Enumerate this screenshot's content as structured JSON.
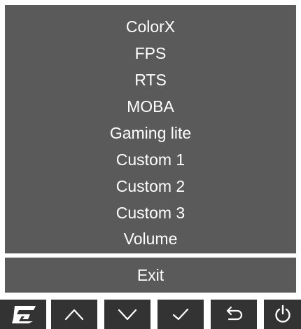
{
  "menu": {
    "items": [
      {
        "label": "ColorX"
      },
      {
        "label": "FPS"
      },
      {
        "label": "RTS"
      },
      {
        "label": "MOBA"
      },
      {
        "label": "Gaming lite"
      },
      {
        "label": "Custom 1"
      },
      {
        "label": "Custom 2"
      },
      {
        "label": "Custom 3"
      },
      {
        "label": "Volume"
      }
    ],
    "exit_label": "Exit"
  },
  "control_keys": [
    {
      "icon": "gigabyte-logo-icon"
    },
    {
      "icon": "chevron-up-icon"
    },
    {
      "icon": "chevron-down-icon"
    },
    {
      "icon": "checkmark-icon"
    },
    {
      "icon": "return-arrow-icon"
    },
    {
      "icon": "power-icon"
    }
  ],
  "colors": {
    "menu_background": "#5a5a5a",
    "key_background": "#333333",
    "text": "#ffffff"
  }
}
